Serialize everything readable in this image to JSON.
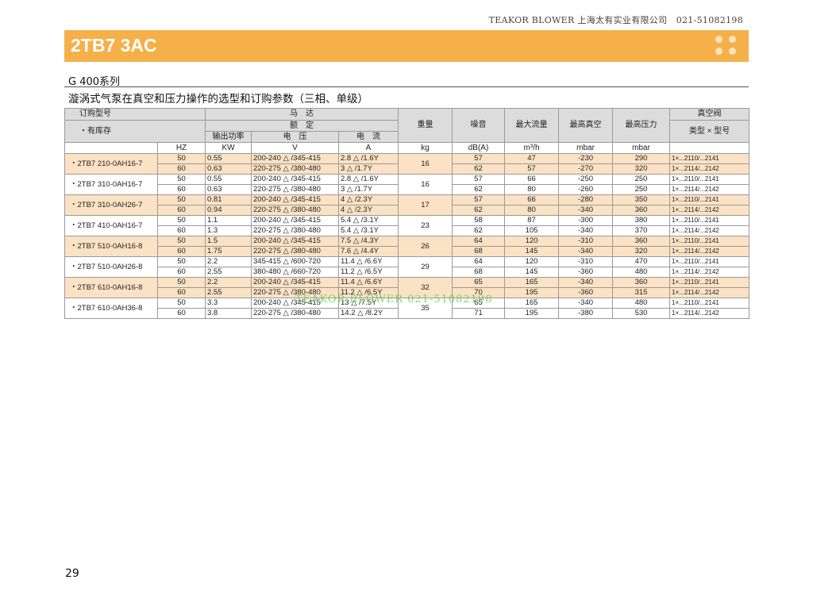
{
  "header": {
    "company": "TEAKOR BLOWER 上海太有实业有限公司　021-51082198",
    "title": "2TB7 3AC"
  },
  "series": "G 400系列",
  "subtitle": "漩涡式气泵在真空和压力操作的选型和订购参数（三相、单级）",
  "table": {
    "h_order": "订购型号",
    "h_stock": "・有库存",
    "h_motor": "马　达",
    "h_rated": "额　定",
    "h_weight": "重量",
    "h_noise": "噪音",
    "h_maxflow": "最大流量",
    "h_maxvac": "最高真空",
    "h_maxpress": "最高压力",
    "h_valve": "真空阀",
    "h_power": "输出功率",
    "h_voltage": "电　压",
    "h_current": "电　流",
    "h_valvetype": "类型 × 型号",
    "u_hz": "HZ",
    "u_kw": "KW",
    "u_v": "V",
    "u_a": "A",
    "u_kg": "kg",
    "u_db": "dB(A)",
    "u_flow": "m³/h",
    "u_vac": "mbar",
    "u_press": "mbar",
    "models": [
      {
        "name": "・2TB7 210-0AH16-7",
        "kg": "16",
        "rows": [
          {
            "hz": "50",
            "kw": "0.55",
            "v": "200-240 △ /345-415",
            "a": "2.8 △ /1.6Y",
            "db": "57",
            "flow": "47",
            "vac": "-230",
            "press": "290",
            "valve": "1×...2110/...2141"
          },
          {
            "hz": "60",
            "kw": "0.63",
            "v": "220-275 △ /380-480",
            "a": "3 △ /1.7Y",
            "db": "62",
            "flow": "57",
            "vac": "-270",
            "press": "320",
            "valve": "1×...2114/...2142"
          }
        ]
      },
      {
        "name": "・2TB7 310-0AH16-7",
        "kg": "16",
        "rows": [
          {
            "hz": "50",
            "kw": "0.55",
            "v": "200-240 △ /345-415",
            "a": "2.8 △ /1.6Y",
            "db": "57",
            "flow": "66",
            "vac": "-250",
            "press": "250",
            "valve": "1×...2110/...2141"
          },
          {
            "hz": "60",
            "kw": "0.63",
            "v": "220-275 △ /380-480",
            "a": "3 △ /1.7Y",
            "db": "62",
            "flow": "80",
            "vac": "-260",
            "press": "250",
            "valve": "1×...2114/...2142"
          }
        ]
      },
      {
        "name": "・2TB7 310-0AH26-7",
        "kg": "17",
        "rows": [
          {
            "hz": "50",
            "kw": "0.81",
            "v": "200-240 △ /345-415",
            "a": "4 △ /2.3Y",
            "db": "57",
            "flow": "66",
            "vac": "-280",
            "press": "350",
            "valve": "1×...2110/...2141"
          },
          {
            "hz": "60",
            "kw": "0.94",
            "v": "220-275 △ /380-480",
            "a": "4 △ /2.3Y",
            "db": "62",
            "flow": "80",
            "vac": "-340",
            "press": "360",
            "valve": "1×...2114/...2142"
          }
        ]
      },
      {
        "name": "・2TB7 410-0AH16-7",
        "kg": "23",
        "rows": [
          {
            "hz": "50",
            "kw": "1.1",
            "v": "200-240 △ /345-415",
            "a": "5.4 △ /3.1Y",
            "db": "58",
            "flow": "87",
            "vac": "-300",
            "press": "380",
            "valve": "1×...2110/...2141"
          },
          {
            "hz": "60",
            "kw": "1.3",
            "v": "220-275 △ /380-480",
            "a": "5.4 △ /3.1Y",
            "db": "62",
            "flow": "105",
            "vac": "-340",
            "press": "370",
            "valve": "1×...2114/...2142"
          }
        ]
      },
      {
        "name": "・2TB7 510-0AH16-8",
        "kg": "26",
        "rows": [
          {
            "hz": "50",
            "kw": "1.5",
            "v": "200-240 △ /345-415",
            "a": "7.5 △ /4.3Y",
            "db": "64",
            "flow": "120",
            "vac": "-310",
            "press": "360",
            "valve": "1×...2110/...2141"
          },
          {
            "hz": "60",
            "kw": "1.75",
            "v": "220-275 △ /380-480",
            "a": "7.6 △ /4.4Y",
            "db": "68",
            "flow": "145",
            "vac": "-340",
            "press": "320",
            "valve": "1×...2114/...2142"
          }
        ]
      },
      {
        "name": "・2TB7 510-0AH26-8",
        "kg": "29",
        "rows": [
          {
            "hz": "50",
            "kw": "2.2",
            "v": "345-415 △ /600-720",
            "a": "11.4 △ /6.6Y",
            "db": "64",
            "flow": "120",
            "vac": "-310",
            "press": "470",
            "valve": "1×...2110/...2141"
          },
          {
            "hz": "60",
            "kw": "2.55",
            "v": "380-480 △ /660-720",
            "a": "11.2 △ /6.5Y",
            "db": "68",
            "flow": "145",
            "vac": "-360",
            "press": "480",
            "valve": "1×...2114/...2142"
          }
        ]
      },
      {
        "name": "・2TB7 610-0AH16-8",
        "kg": "32",
        "rows": [
          {
            "hz": "50",
            "kw": "2.2",
            "v": "200-240 △ /345-415",
            "a": "11.4 △ /6.6Y",
            "db": "65",
            "flow": "165",
            "vac": "-340",
            "press": "360",
            "valve": "1×...2110/...2141"
          },
          {
            "hz": "60",
            "kw": "2.55",
            "v": "220-275 △ /380-480",
            "a": "11.2 △ /6.5Y",
            "db": "70",
            "flow": "195",
            "vac": "-360",
            "press": "315",
            "valve": "1×...2114/...2142"
          }
        ]
      },
      {
        "name": "・2TB7 610-0AH36-8",
        "kg": "35",
        "rows": [
          {
            "hz": "50",
            "kw": "3.3",
            "v": "200-240 △ /345-415",
            "a": "13 △ /7.5Y",
            "db": "65",
            "flow": "165",
            "vac": "-340",
            "press": "480",
            "valve": "1×...2110/...2141"
          },
          {
            "hz": "60",
            "kw": "3.8",
            "v": "220-275 △ /380-480",
            "a": "14.2 △ /8.2Y",
            "db": "71",
            "flow": "195",
            "vac": "-380",
            "press": "530",
            "valve": "1×...2114/...2142"
          }
        ]
      }
    ]
  },
  "watermark": "TEAKOR BLOWER 021-51082198",
  "page_number": "29",
  "colors": {
    "banner": "#f5b04a",
    "row_highlight": "#fbe2c4",
    "header_bg": "#dcdcdc"
  }
}
